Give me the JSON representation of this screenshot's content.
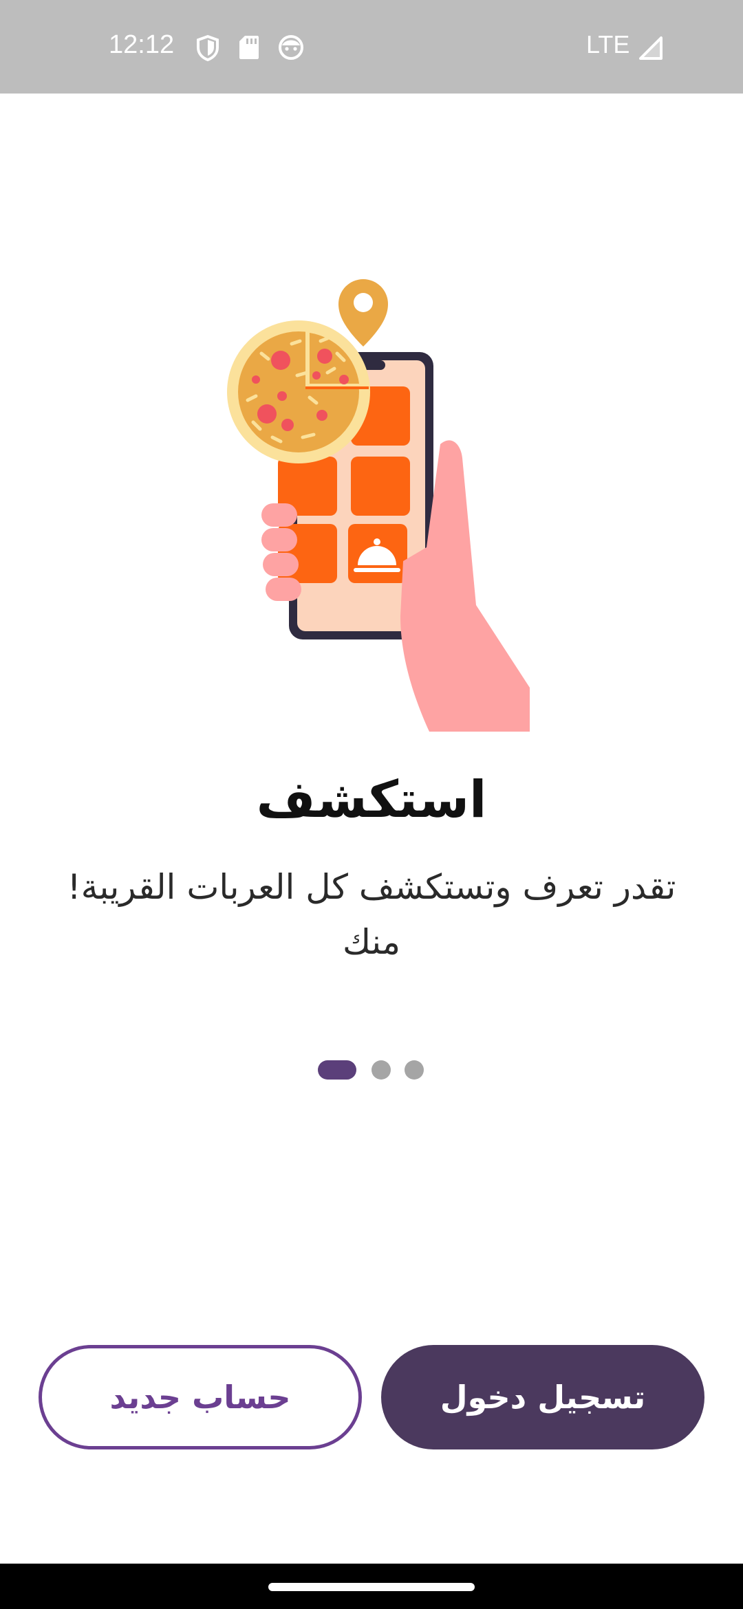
{
  "status_bar": {
    "time": "12:12",
    "network": "LTE",
    "icons": [
      "shield-icon",
      "sd-card-icon",
      "face-icon",
      "signal-icon"
    ]
  },
  "onboarding": {
    "title": "استكشف",
    "description": "تقدر تعرف وتستكشف كل العربات القريبة! منك",
    "illustration": [
      "phone-icon",
      "pizza-icon",
      "location-pin-icon",
      "cloche-icon",
      "hand-icon"
    ],
    "pager": {
      "pages": 3,
      "current": 1
    }
  },
  "actions": {
    "register_label": "حساب جديد",
    "login_label": "تسجيل دخول"
  },
  "colors": {
    "primary": "#4b395e",
    "outline": "#6b3f91",
    "accent_orange": "#fd6512",
    "pin": "#eaa845",
    "dot_inactive": "#a5a5a5",
    "status_bar": "#bdbdbd"
  }
}
